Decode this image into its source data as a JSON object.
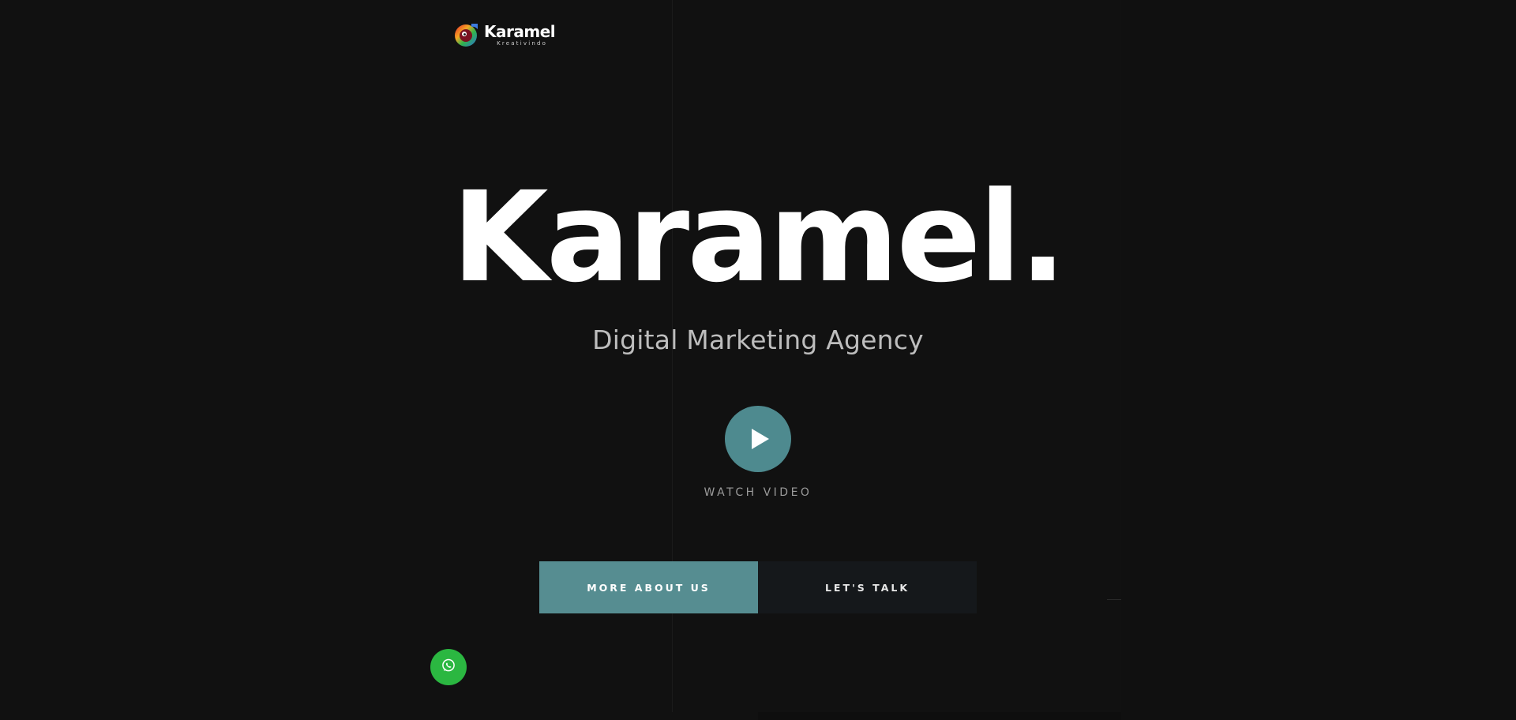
{
  "brand": {
    "name": "Karamel",
    "tagline": "Kreativindo"
  },
  "hero": {
    "title": "Karamel.",
    "subtitle": "Digital Marketing Agency"
  },
  "video": {
    "label": "WATCH VIDEO"
  },
  "cta": {
    "primary_label": "MORE ABOUT US",
    "secondary_label": "LET'S TALK"
  },
  "icons": {
    "play": "play-icon",
    "whatsapp": "whatsapp-icon",
    "logo": "karamel-logo-mark"
  },
  "colors": {
    "background": "#111111",
    "accent": "#568d91",
    "whatsapp": "#2bb741"
  }
}
